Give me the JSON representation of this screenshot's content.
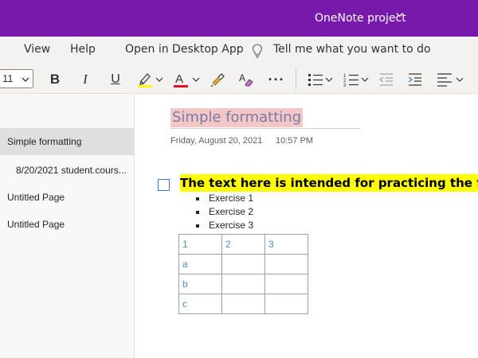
{
  "titlebar": {
    "title": "OneNote project"
  },
  "menu": {
    "items": [
      "View",
      "Help",
      "Open in Desktop App"
    ],
    "tell_me": "Tell me what you want to do"
  },
  "toolbar": {
    "font_size": "11",
    "bold_label": "B",
    "italic_label": "I",
    "underline_label": "U",
    "more_label": "···",
    "highlight_color": "#ffff00",
    "font_color": "#e81123"
  },
  "sidebar": {
    "pages": [
      {
        "label": "Simple formatting",
        "selected": true
      },
      {
        "label": "8/20/2021 student.cours..."
      },
      {
        "label": "Untitled Page"
      },
      {
        "label": "Untitled Page"
      }
    ]
  },
  "page": {
    "title": "Simple formatting",
    "date": "Friday, August 20, 2021",
    "time": "10:57 PM",
    "highlight_text": "The text here is intended for practicing the formatting",
    "bullets": [
      "Exercise 1",
      "Exercise 2",
      "Exercise 3"
    ],
    "table": [
      [
        "1",
        "2",
        "3"
      ],
      [
        "a",
        "",
        ""
      ],
      [
        "b",
        "",
        ""
      ],
      [
        "c",
        "",
        ""
      ]
    ]
  },
  "colors": {
    "brand": "#7719aa",
    "title_highlight": "#f4c7c7",
    "text_highlight": "#ffff00",
    "table_text": "#4a90c8"
  }
}
